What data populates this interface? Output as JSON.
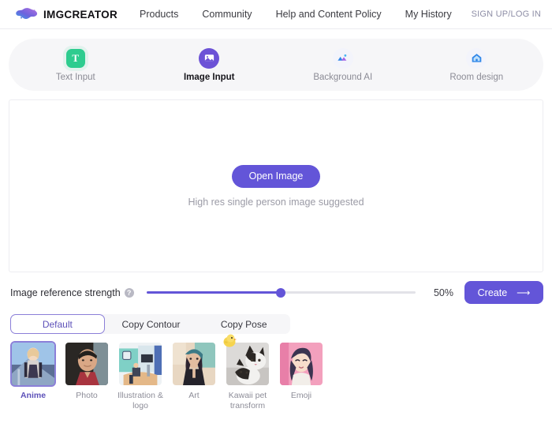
{
  "header": {
    "brand_name": "IMGCREATOR",
    "brand_logo_icon": "blob-logo-icon",
    "nav": [
      {
        "label": "Products"
      },
      {
        "label": "Community"
      },
      {
        "label": "Help and Content Policy"
      },
      {
        "label": "My History"
      }
    ],
    "signin_label": "SIGN UP/LOG IN"
  },
  "mode_tabs": [
    {
      "label": "Text Input",
      "icon": "text-input-icon",
      "active": false
    },
    {
      "label": "Image Input",
      "icon": "image-input-icon",
      "active": true
    },
    {
      "label": "Background AI",
      "icon": "background-ai-icon",
      "active": false
    },
    {
      "label": "Room design",
      "icon": "room-design-icon",
      "active": false
    }
  ],
  "dropzone": {
    "button_label": "Open Image",
    "hint": "High res single person image suggested"
  },
  "strength": {
    "label": "Image reference strength",
    "help_icon": "help-circle-icon",
    "value_label": "50%",
    "value": 50,
    "min": 0,
    "max": 100
  },
  "create": {
    "label": "Create",
    "arrow_icon": "arrow-right-icon"
  },
  "copy_modes": [
    {
      "label": "Default",
      "active": true
    },
    {
      "label": "Copy Contour",
      "active": false
    },
    {
      "label": "Copy Pose",
      "active": false
    }
  ],
  "styles": [
    {
      "label": "Anime",
      "active": true,
      "badge": null
    },
    {
      "label": "Photo",
      "active": false,
      "badge": null
    },
    {
      "label": "Illustration & logo",
      "active": false,
      "badge": null
    },
    {
      "label": "Art",
      "active": false,
      "badge": null
    },
    {
      "label": "Kawaii pet transform",
      "active": false,
      "badge": "chick-badge-icon"
    },
    {
      "label": "Emoji",
      "active": false,
      "badge": null
    }
  ],
  "colors": {
    "accent_purple": "#6355d8",
    "accent_purple_light": "#8b7fd8",
    "green": "#2ecc8f",
    "blue": "#2f86e8",
    "track_gray": "#e2e2e8",
    "panel_gray": "#f6f6f8"
  }
}
